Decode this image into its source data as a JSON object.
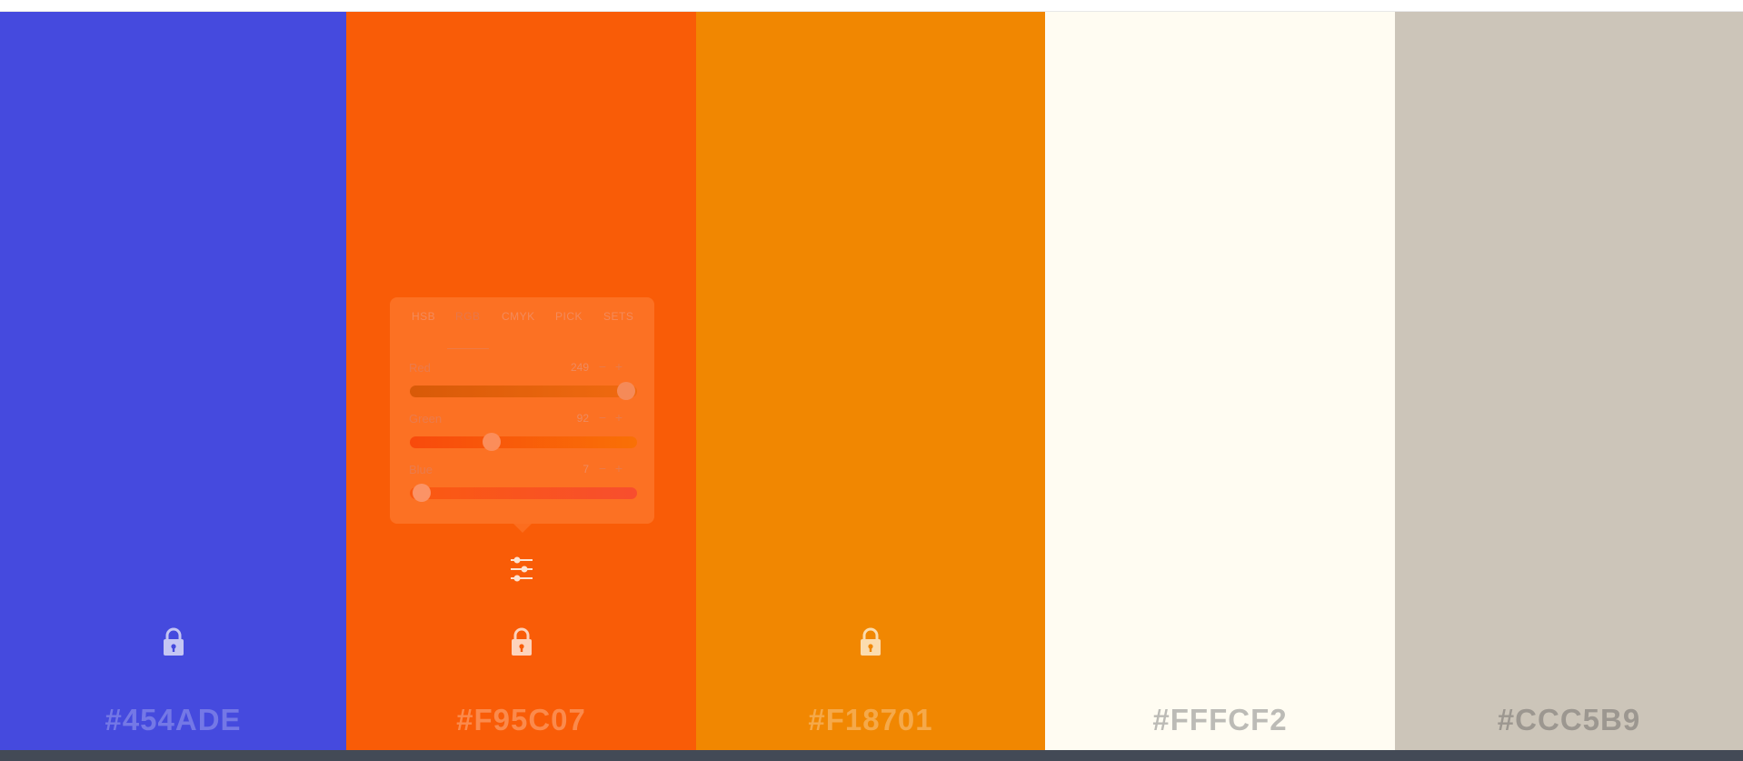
{
  "palette": {
    "swatches": [
      {
        "hex": "#454ADE",
        "bg": "#454ADE",
        "text_color": "#7478e6",
        "icon_color": "#c5c6f3",
        "locked": true
      },
      {
        "hex": "#F95C07",
        "bg": "#F95C07",
        "text_color": "#fb8a4c",
        "icon_color": "#fdd3bc",
        "locked": true
      },
      {
        "hex": "#F18701",
        "bg": "#F18701",
        "text_color": "#f5a94a",
        "icon_color": "#fbdcae",
        "locked": true
      },
      {
        "hex": "#FFFCF2",
        "bg": "#FFFCF2",
        "text_color": "#bcbbb6",
        "icon_color": "#e9e6dd",
        "locked": false
      },
      {
        "hex": "#CCC5B9",
        "bg": "#CCC5B9",
        "text_color": "#9c9790",
        "icon_color": "#b4ada2",
        "locked": false
      }
    ]
  },
  "adjust_panel": {
    "tabs": [
      "HSB",
      "RGB",
      "CMYK",
      "PICK",
      "SETS"
    ],
    "active_tab": "RGB",
    "channels": [
      {
        "label": "Red",
        "value": 249,
        "max": 255,
        "minus": "−",
        "plus": "+"
      },
      {
        "label": "Green",
        "value": 92,
        "max": 255,
        "minus": "−",
        "plus": "+"
      },
      {
        "label": "Blue",
        "value": 7,
        "max": 255,
        "minus": "−",
        "plus": "+"
      }
    ]
  },
  "icons": {
    "lock": "lock-icon",
    "adjust": "sliders-icon"
  },
  "colors": {
    "bottom_bar": "#434a56",
    "panel_bg": "rgba(255,140,70,0.45)"
  }
}
